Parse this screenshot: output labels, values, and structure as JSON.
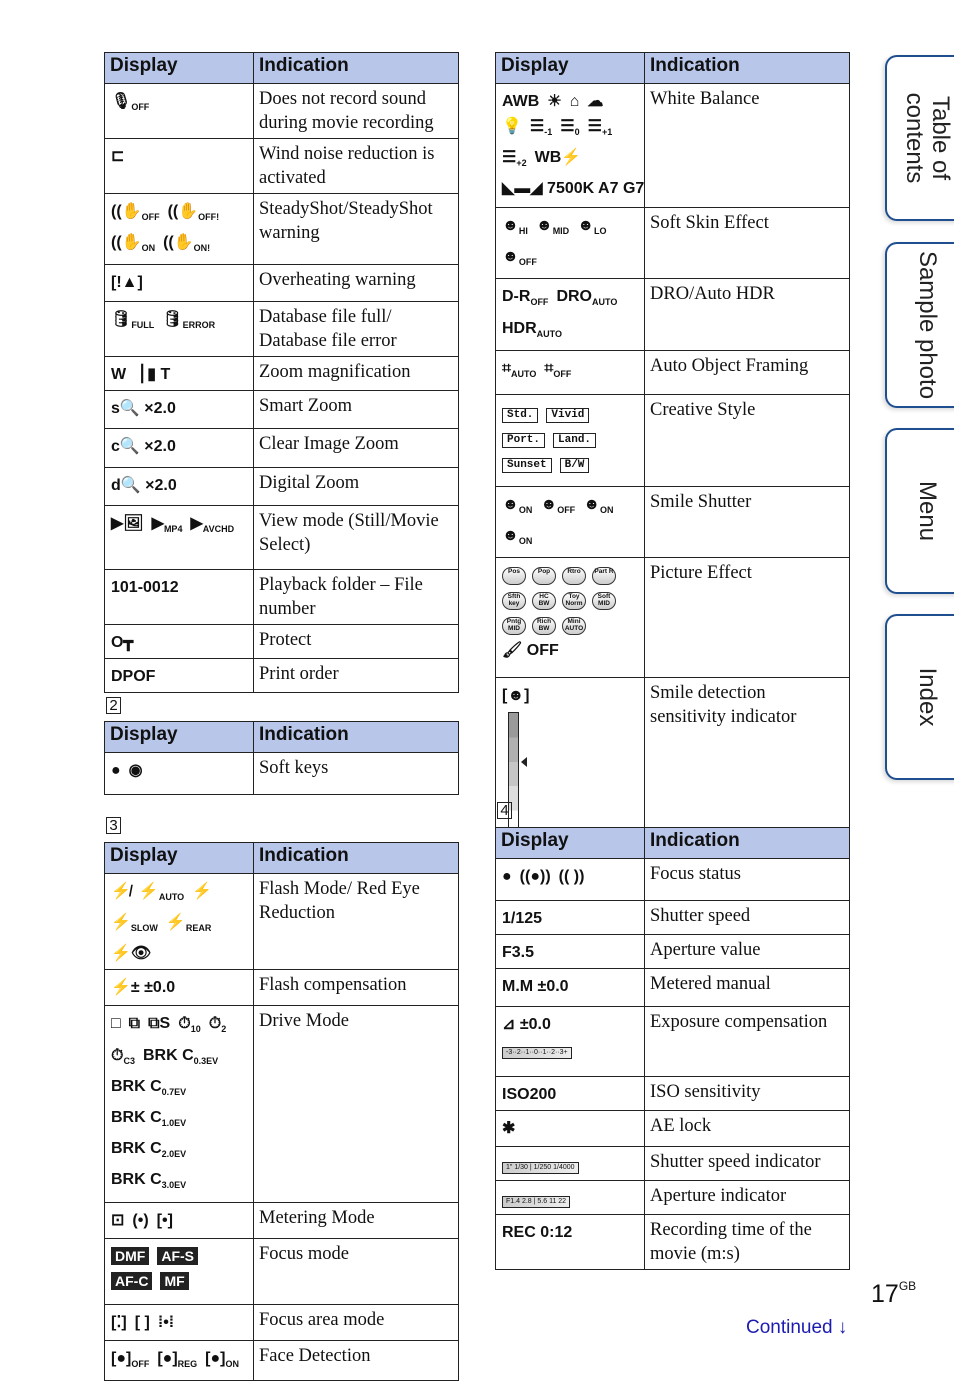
{
  "headers": {
    "display": "Display",
    "indication": "Indication"
  },
  "section_numbers": {
    "s2": "2",
    "s3": "3",
    "s4": "4"
  },
  "table1": [
    {
      "icons": [
        {
          "glyph": "🎙",
          "sub": "OFF",
          "name": "mic-off-icon"
        }
      ],
      "indication": "Does not record sound during movie recording"
    },
    {
      "icons": [
        {
          "glyph": "⊏",
          "sub": "",
          "name": "wind-noise-icon"
        }
      ],
      "indication": "Wind noise reduction is activated"
    },
    {
      "icons": [
        {
          "glyph": "((✋",
          "sub": "OFF",
          "name": "steadyshot-off-icon"
        },
        {
          "glyph": "((✋",
          "sub": "OFF!",
          "name": "steadyshot-off-warning-icon"
        },
        {
          "glyph": "((✋",
          "sub": "ON",
          "name": "steadyshot-on-icon"
        },
        {
          "glyph": "((✋",
          "sub": "ON!",
          "name": "steadyshot-on-warning-icon"
        }
      ],
      "indication": "SteadyShot/SteadyShot warning"
    },
    {
      "icons": [
        {
          "glyph": "[ǃ▲]",
          "sub": "",
          "name": "overheating-icon"
        }
      ],
      "indication": "Overheating warning"
    },
    {
      "icons": [
        {
          "glyph": "🛢",
          "sub": "FULL",
          "name": "database-full-icon"
        },
        {
          "glyph": "🛢",
          "sub": "ERROR",
          "name": "database-error-icon"
        }
      ],
      "indication": "Database file full/ Database file error"
    },
    {
      "icons": [
        {
          "glyph": "W ▕ ▮ T",
          "sub": "",
          "name": "zoom-bar-icon"
        }
      ],
      "indication": "Zoom magnification"
    },
    {
      "icons": [
        {
          "glyph": "s🔍 ×2.0",
          "sub": "",
          "name": "smart-zoom-icon"
        }
      ],
      "indication": "Smart Zoom"
    },
    {
      "icons": [
        {
          "glyph": "c🔍 ×2.0",
          "sub": "",
          "name": "clear-image-zoom-icon"
        }
      ],
      "indication": "Clear Image Zoom"
    },
    {
      "icons": [
        {
          "glyph": "d🔍 ×2.0",
          "sub": "",
          "name": "digital-zoom-icon"
        }
      ],
      "indication": "Digital Zoom"
    },
    {
      "icons": [
        {
          "glyph": "▶🖼",
          "sub": "",
          "name": "view-still-icon"
        },
        {
          "glyph": "▶",
          "sub": "MP4",
          "name": "view-mp4-icon"
        },
        {
          "glyph": "▶",
          "sub": "AVCHD",
          "name": "view-avchd-icon"
        }
      ],
      "indication": "View mode (Still/Movie Select)"
    },
    {
      "icons": [
        {
          "glyph": "101-0012",
          "sub": "",
          "name": "folder-file-number"
        }
      ],
      "indication": "Playback folder – File number"
    },
    {
      "icons": [
        {
          "glyph": "O┳",
          "sub": "",
          "name": "protect-key-icon"
        }
      ],
      "indication": "Protect"
    },
    {
      "icons": [
        {
          "glyph": "DPOF",
          "sub": "",
          "name": "dpof-icon"
        }
      ],
      "indication": "Print order"
    }
  ],
  "table2": [
    {
      "icons": [
        {
          "glyph": "●",
          "sub": "",
          "name": "soft-key-dot-icon"
        },
        {
          "glyph": "◉",
          "sub": "",
          "name": "soft-key-dial-icon"
        }
      ],
      "indication": "Soft keys"
    }
  ],
  "table3": [
    {
      "icons": [
        {
          "glyph": "⚡̸",
          "sub": "",
          "name": "flash-off-icon"
        },
        {
          "glyph": "⚡",
          "sub": "AUTO",
          "name": "flash-auto-icon"
        },
        {
          "glyph": "⚡",
          "sub": "",
          "name": "flash-fill-icon"
        },
        {
          "glyph": "⚡",
          "sub": "SLOW",
          "name": "flash-slow-icon"
        },
        {
          "glyph": "⚡",
          "sub": "REAR",
          "name": "flash-rear-icon"
        },
        {
          "glyph": "⚡👁",
          "sub": "",
          "name": "red-eye-icon"
        }
      ],
      "indication": "Flash Mode/ Red Eye Reduction"
    },
    {
      "icons": [
        {
          "glyph": "⚡± ±0.0",
          "sub": "",
          "name": "flash-compensation-icon"
        }
      ],
      "indication": "Flash compensation"
    },
    {
      "icons": [
        {
          "glyph": "□",
          "sub": "",
          "name": "single-shot-icon"
        },
        {
          "glyph": "⧉",
          "sub": "",
          "name": "continuous-icon"
        },
        {
          "glyph": "⧉S",
          "sub": "",
          "name": "speed-priority-icon"
        },
        {
          "glyph": "⏱",
          "sub": "10",
          "name": "self-timer-10-icon"
        },
        {
          "glyph": "⏱",
          "sub": "2",
          "name": "self-timer-2-icon"
        },
        {
          "glyph": "⏱",
          "sub": "C3",
          "name": "self-timer-c3-icon"
        },
        {
          "glyph": "BRK C",
          "sub": "0.3EV",
          "name": "bracket-03-icon"
        },
        {
          "glyph": "BRK C",
          "sub": "0.7EV",
          "name": "bracket-07-icon"
        },
        {
          "glyph": "BRK C",
          "sub": "1.0EV",
          "name": "bracket-10-icon"
        },
        {
          "glyph": "BRK C",
          "sub": "2.0EV",
          "name": "bracket-20-icon"
        },
        {
          "glyph": "BRK C",
          "sub": "3.0EV",
          "name": "bracket-30-icon"
        }
      ],
      "indication": "Drive Mode"
    },
    {
      "icons": [
        {
          "glyph": "⊡",
          "sub": "",
          "name": "multi-metering-icon"
        },
        {
          "glyph": "(•)",
          "sub": "",
          "name": "center-metering-icon"
        },
        {
          "glyph": "[•]",
          "sub": "",
          "name": "spot-metering-icon"
        }
      ],
      "indication": "Metering Mode"
    },
    {
      "icons": [
        {
          "glyph": "DMF",
          "sub": "",
          "name": "dmf-icon"
        },
        {
          "glyph": "AF-S",
          "sub": "",
          "name": "af-s-icon"
        },
        {
          "glyph": "AF-C",
          "sub": "",
          "name": "af-c-icon"
        },
        {
          "glyph": "MF",
          "sub": "",
          "name": "mf-icon"
        }
      ],
      "indication": "Focus mode"
    },
    {
      "icons": [
        {
          "glyph": "[⁚]",
          "sub": "",
          "name": "wide-area-icon"
        },
        {
          "glyph": "[ ]",
          "sub": "",
          "name": "center-area-icon"
        },
        {
          "glyph": "⁞•⁞",
          "sub": "",
          "name": "flexible-spot-icon"
        }
      ],
      "indication": "Focus area mode"
    },
    {
      "icons": [
        {
          "glyph": "[●]",
          "sub": "OFF",
          "name": "face-detect-off-icon"
        },
        {
          "glyph": "[●]",
          "sub": "REG",
          "name": "face-detect-registered-icon"
        },
        {
          "glyph": "[●]",
          "sub": "ON",
          "name": "face-detect-on-icon"
        }
      ],
      "indication": "Face Detection"
    }
  ],
  "table_r1": [
    {
      "icons": [
        {
          "glyph": "AWB",
          "sub": "",
          "name": "awb-icon"
        },
        {
          "glyph": "☀",
          "sub": "",
          "name": "daylight-icon"
        },
        {
          "glyph": "⌂",
          "sub": "",
          "name": "shade-icon"
        },
        {
          "glyph": "☁",
          "sub": "",
          "name": "cloudy-icon"
        },
        {
          "glyph": "💡",
          "sub": "",
          "name": "incandescent-icon"
        },
        {
          "glyph": "☰",
          "sub": "-1",
          "name": "fluor-minus1-icon"
        },
        {
          "glyph": "☰",
          "sub": "0",
          "name": "fluor-0-icon"
        },
        {
          "glyph": "☰",
          "sub": "+1",
          "name": "fluor-plus1-icon"
        },
        {
          "glyph": "☰",
          "sub": "+2",
          "name": "fluor-plus2-icon"
        },
        {
          "glyph": "WB⚡",
          "sub": "",
          "name": "flash-wb-icon"
        },
        {
          "glyph": "◣▬◢ 7500K A7 G7",
          "sub": "",
          "name": "custom-wb-icon"
        }
      ],
      "indication": "White Balance"
    },
    {
      "icons": [
        {
          "glyph": "☻",
          "sub": "HI",
          "name": "soft-skin-hi-icon"
        },
        {
          "glyph": "☻",
          "sub": "MID",
          "name": "soft-skin-mid-icon"
        },
        {
          "glyph": "☻",
          "sub": "LO",
          "name": "soft-skin-lo-icon"
        },
        {
          "glyph": "☻",
          "sub": "OFF",
          "name": "soft-skin-off-icon"
        }
      ],
      "indication": "Soft Skin Effect"
    },
    {
      "icons": [
        {
          "glyph": "D-R",
          "sub": "OFF",
          "name": "dro-off-icon"
        },
        {
          "glyph": "DRO",
          "sub": "AUTO",
          "name": "dro-auto-icon"
        },
        {
          "glyph": "HDR",
          "sub": "AUTO",
          "name": "hdr-auto-icon"
        }
      ],
      "indication": "DRO/Auto HDR"
    },
    {
      "icons": [
        {
          "glyph": "⌗",
          "sub": "AUTO",
          "name": "framing-auto-icon"
        },
        {
          "glyph": "⌗",
          "sub": "OFF",
          "name": "framing-off-icon"
        }
      ],
      "indication": "Auto Object Framing"
    },
    {
      "icons": [
        {
          "glyph": "Std.",
          "sub": "",
          "name": "style-standard-icon"
        },
        {
          "glyph": "Vivid",
          "sub": "",
          "name": "style-vivid-icon"
        },
        {
          "glyph": "Port.",
          "sub": "",
          "name": "style-portrait-icon"
        },
        {
          "glyph": "Land.",
          "sub": "",
          "name": "style-landscape-icon"
        },
        {
          "glyph": "Sunset",
          "sub": "",
          "name": "style-sunset-icon"
        },
        {
          "glyph": "B/W",
          "sub": "",
          "name": "style-bw-icon"
        }
      ],
      "indication": "Creative Style"
    },
    {
      "icons": [
        {
          "glyph": "☻",
          "sub": "ON",
          "name": "smile-on-1-icon"
        },
        {
          "glyph": "☻",
          "sub": "OFF",
          "name": "smile-off-icon"
        },
        {
          "glyph": "☻",
          "sub": "ON",
          "name": "smile-on-2-icon"
        },
        {
          "glyph": "☻",
          "sub": "ON",
          "name": "smile-on-3-icon"
        }
      ],
      "indication": "Smile Shutter"
    },
    {
      "icons": [
        {
          "glyph": "Pos",
          "sub": "",
          "name": "effect-posterization-icon"
        },
        {
          "glyph": "Pop",
          "sub": "",
          "name": "effect-pop-icon"
        },
        {
          "glyph": "Rtro",
          "sub": "",
          "name": "effect-retro-icon"
        },
        {
          "glyph": "Part R",
          "sub": "",
          "name": "effect-partial-icon"
        },
        {
          "glyph": "Sfth key",
          "sub": "",
          "name": "effect-high-key-icon"
        },
        {
          "glyph": "HC BW",
          "sub": "",
          "name": "effect-hc-bw-icon"
        },
        {
          "glyph": "Toy Norm",
          "sub": "",
          "name": "effect-toy-icon"
        },
        {
          "glyph": "Soft MID",
          "sub": "",
          "name": "effect-soft-focus-icon"
        },
        {
          "glyph": "Pntg MID",
          "sub": "",
          "name": "effect-hdr-painting-icon"
        },
        {
          "glyph": "Rich BW",
          "sub": "",
          "name": "effect-rich-bw-icon"
        },
        {
          "glyph": "Mini AUTO",
          "sub": "",
          "name": "effect-miniature-icon"
        },
        {
          "glyph": "🖌 OFF",
          "sub": "",
          "name": "effect-off-icon"
        }
      ],
      "indication": "Picture Effect"
    },
    {
      "icons": [
        {
          "glyph": "[☻]",
          "sub": "",
          "name": "smile-sensitivity-icon"
        }
      ],
      "indication": "Smile detection sensitivity indicator",
      "sensitivity_level": 0.6
    }
  ],
  "table4": [
    {
      "icons": [
        {
          "glyph": "●",
          "sub": "",
          "name": "focus-locked-icon"
        },
        {
          "glyph": "((●))",
          "sub": "",
          "name": "focus-confirmed-icon"
        },
        {
          "glyph": "(( ))",
          "sub": "",
          "name": "focusing-icon"
        }
      ],
      "indication": "Focus status"
    },
    {
      "icons": [
        {
          "glyph": "1/125",
          "sub": "",
          "name": "shutter-speed-value"
        }
      ],
      "indication": "Shutter speed"
    },
    {
      "icons": [
        {
          "glyph": "F3.5",
          "sub": "",
          "name": "aperture-value"
        }
      ],
      "indication": "Aperture value"
    },
    {
      "icons": [
        {
          "glyph": "M.M ±0.0",
          "sub": "",
          "name": "metered-manual-icon"
        }
      ],
      "indication": "Metered manual"
    },
    {
      "icons": [
        {
          "glyph": "⊿ ±0.0",
          "sub": "",
          "name": "exposure-comp-icon"
        },
        {
          "glyph": "-3··2··1··0··1··2··3+",
          "sub": "",
          "name": "exposure-scale"
        }
      ],
      "indication": "Exposure compensation"
    },
    {
      "icons": [
        {
          "glyph": "ISO200",
          "sub": "",
          "name": "iso-value"
        }
      ],
      "indication": "ISO sensitivity"
    },
    {
      "icons": [
        {
          "glyph": "✱",
          "sub": "",
          "name": "ae-lock-icon"
        }
      ],
      "indication": "AE lock"
    },
    {
      "icons": [
        {
          "glyph": "1\" 1/30 | 1/250 1/4000",
          "sub": "",
          "name": "shutter-indicator-scale"
        }
      ],
      "indication": "Shutter speed indicator"
    },
    {
      "icons": [
        {
          "glyph": "F1.4 2.8 | 5.6 11 22",
          "sub": "",
          "name": "aperture-indicator-scale"
        }
      ],
      "indication": "Aperture indicator"
    },
    {
      "icons": [
        {
          "glyph": "REC 0:12",
          "sub": "",
          "name": "rec-time-value"
        }
      ],
      "indication": "Recording time of the movie (m:s)"
    }
  ],
  "side_tabs": [
    "Table of contents",
    "Sample photo",
    "Menu",
    "Index"
  ],
  "footer": {
    "page_number": "17",
    "page_suffix": "GB",
    "continued": "Continued",
    "continued_arrow": "↓"
  },
  "colors": {
    "header_bg": "#b8c6ea",
    "tab_border": "#1f4f8f",
    "continued_link": "#1c1cb0"
  }
}
